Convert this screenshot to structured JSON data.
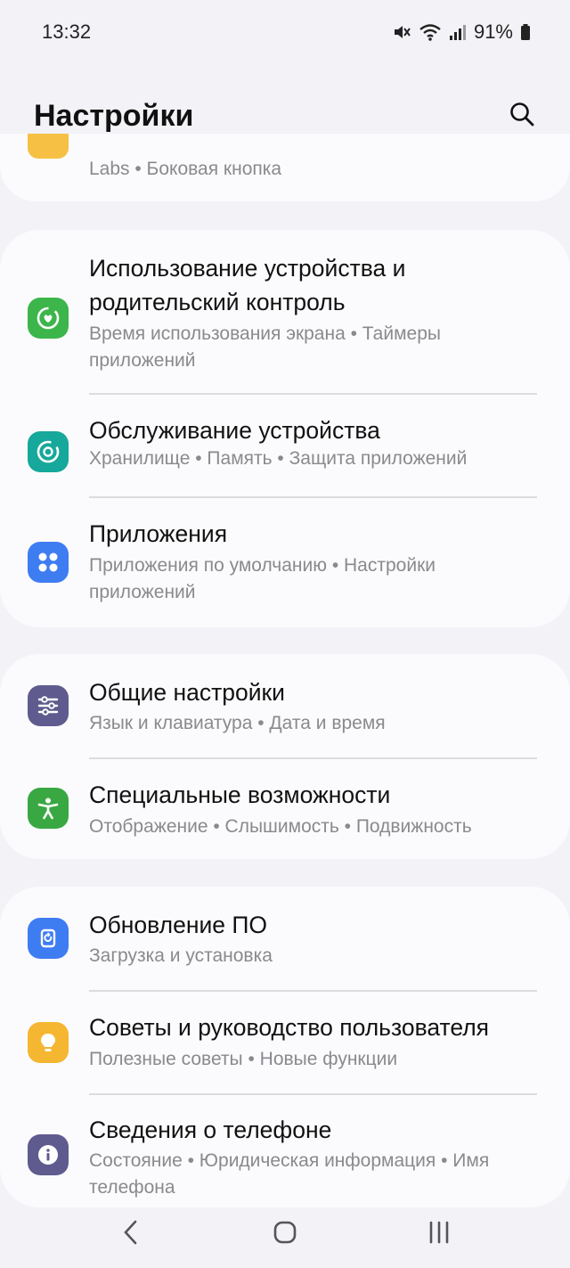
{
  "status": {
    "time": "13:32",
    "battery": "91%",
    "icons": [
      "mute-icon",
      "wifi-icon",
      "signal-icon",
      "battery-icon"
    ]
  },
  "header": {
    "title": "Настройки",
    "search_icon": "search-icon"
  },
  "partial_item": {
    "subtitle": "Labs  •  Боковая кнопка",
    "icon_color": "#f5c044"
  },
  "groups": [
    {
      "items": [
        {
          "title": "Использование устройства и родительский контроль",
          "subtitle": "Время использования экрана  •  Таймеры приложений",
          "icon": "digital-wellbeing-icon",
          "icon_color": "#3cb54a"
        },
        {
          "title": "Обслуживание устройства",
          "subtitle": "Хранилище  •  Память  •  Защита приложений",
          "icon": "device-care-icon",
          "icon_color": "#16a89a"
        },
        {
          "title": "Приложения",
          "subtitle": "Приложения по умолчанию  •  Настройки приложений",
          "icon": "apps-icon",
          "icon_color": "#3e7cf2"
        }
      ]
    },
    {
      "items": [
        {
          "title": "Общие настройки",
          "subtitle": "Язык и клавиатура  •  Дата и время",
          "icon": "general-settings-icon",
          "icon_color": "#5f5b8e"
        },
        {
          "title": "Специальные возможности",
          "subtitle": "Отображение  •  Слышимость  •  Подвижность",
          "icon": "accessibility-icon",
          "icon_color": "#39a842"
        }
      ]
    },
    {
      "items": [
        {
          "title": "Обновление ПО",
          "subtitle": "Загрузка и установка",
          "icon": "software-update-icon",
          "icon_color": "#3e7cf2"
        },
        {
          "title": "Советы и руководство пользователя",
          "subtitle": "Полезные советы  •  Новые функции",
          "icon": "tips-icon",
          "icon_color": "#f5b731"
        },
        {
          "title": "Сведения о телефоне",
          "subtitle": "Состояние  •  Юридическая информация  •  Имя телефона",
          "icon": "about-phone-icon",
          "icon_color": "#5f5b8e"
        }
      ]
    }
  ],
  "navbar": {
    "buttons": [
      "back-icon",
      "home-icon",
      "recents-icon"
    ]
  }
}
